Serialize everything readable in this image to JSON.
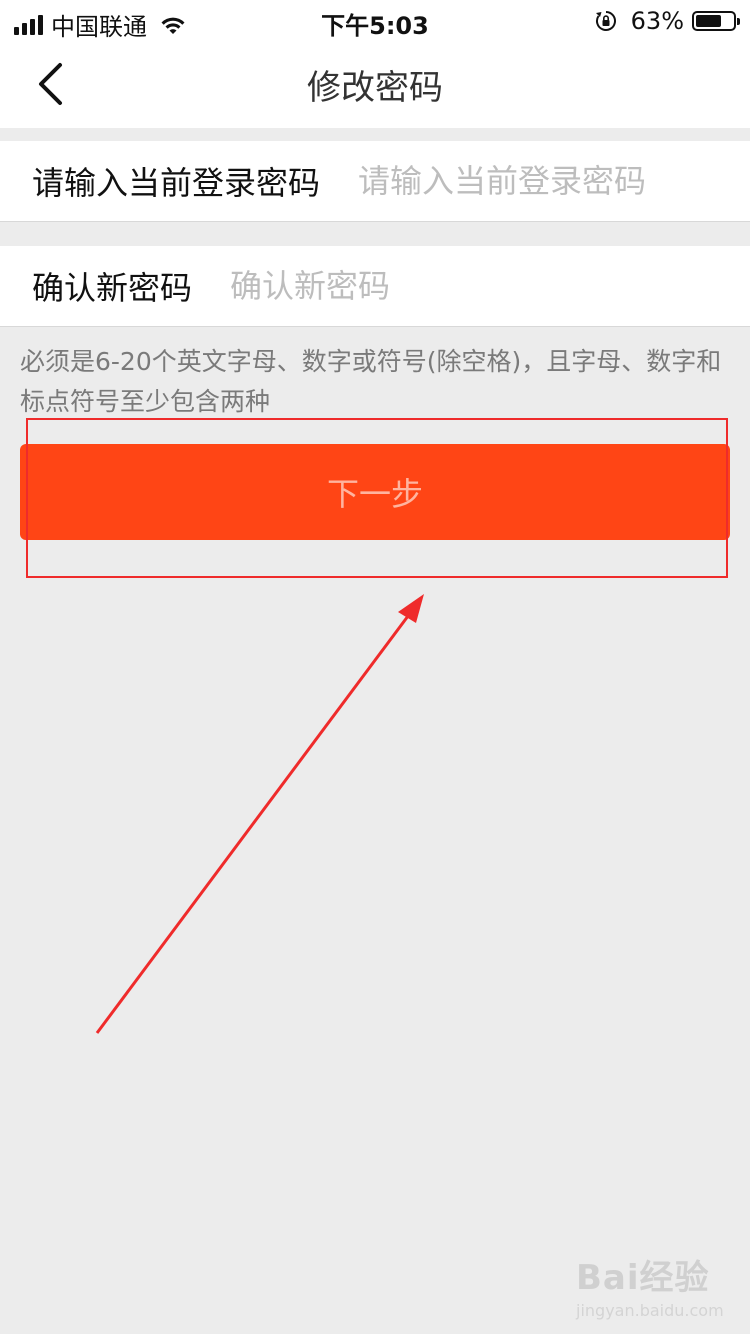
{
  "status_bar": {
    "carrier": "中国联通",
    "time": "下午5:03",
    "battery": "63%",
    "battery_level": 0.63,
    "icons": [
      "signal-icon",
      "wifi-icon",
      "orientation-lock-icon",
      "battery-icon"
    ]
  },
  "nav": {
    "title": "修改密码",
    "back_icon": "chevron-left-icon"
  },
  "form": {
    "current_password": {
      "label": "请输入当前登录密码",
      "placeholder": "请输入当前登录密码",
      "value": ""
    },
    "confirm_password": {
      "label": "确认新密码",
      "placeholder": "确认新密码",
      "value": ""
    },
    "hint": "必须是6-20个英文字母、数字或符号(除空格)，且字母、数字和标点符号至少包含两种"
  },
  "actions": {
    "next_label": "下一步"
  },
  "annotation": {
    "color": "#ef2b2b"
  },
  "watermark": {
    "brand": "Bai经验",
    "url": "jingyan.baidu.com"
  },
  "colors": {
    "primary": "#ff4515",
    "background": "#ececec"
  }
}
